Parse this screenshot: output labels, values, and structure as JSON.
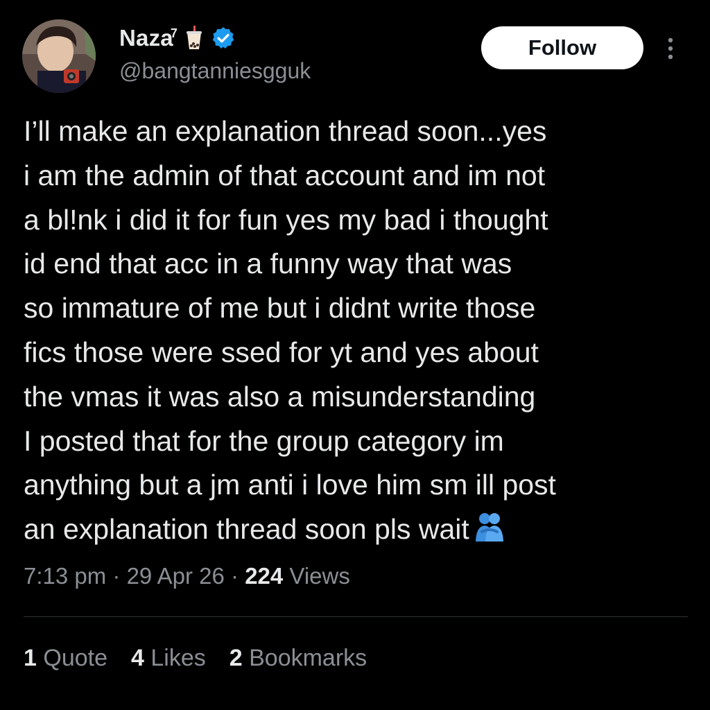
{
  "author": {
    "display_name": "Naza",
    "name_superscript": "7",
    "name_emoji": "bubble-tea-emoji",
    "verified_icon": "verified-badge-icon",
    "handle": "@bangtanniesgguk"
  },
  "header": {
    "follow_label": "Follow",
    "more_icon": "more-vertical-icon"
  },
  "tweet": {
    "lines": [
      "I’ll make an explanation thread soon...yes",
      "i am the admin of that account and im not",
      "a bl!nk i did it for fun yes my bad i thought",
      "id end that acc in a funny way that was",
      "so immature of me but i didnt write those",
      "fics those were ssed for yt and yes about",
      "the vmas it was also a misunderstanding",
      "I posted that for the group category im",
      "anything but a jm anti i love him sm ill post",
      "an explanation thread soon pls wait"
    ],
    "trailing_emoji": "people-hugging-emoji"
  },
  "meta": {
    "time": "7:13 pm",
    "sep1": " · ",
    "date": "29 Apr 26",
    "sep2": " · ",
    "views_count": "224",
    "views_label": " Views"
  },
  "stats": {
    "quotes_count": "1",
    "quotes_label": " Quote",
    "likes_count": "4",
    "likes_label": " Likes",
    "bookmarks_count": "2",
    "bookmarks_label": " Bookmarks"
  },
  "colors": {
    "background": "#000000",
    "text_primary": "#e7e9ea",
    "text_secondary": "#8b8f94",
    "verified_blue": "#1d9bf0",
    "follow_bg": "#ffffff"
  }
}
